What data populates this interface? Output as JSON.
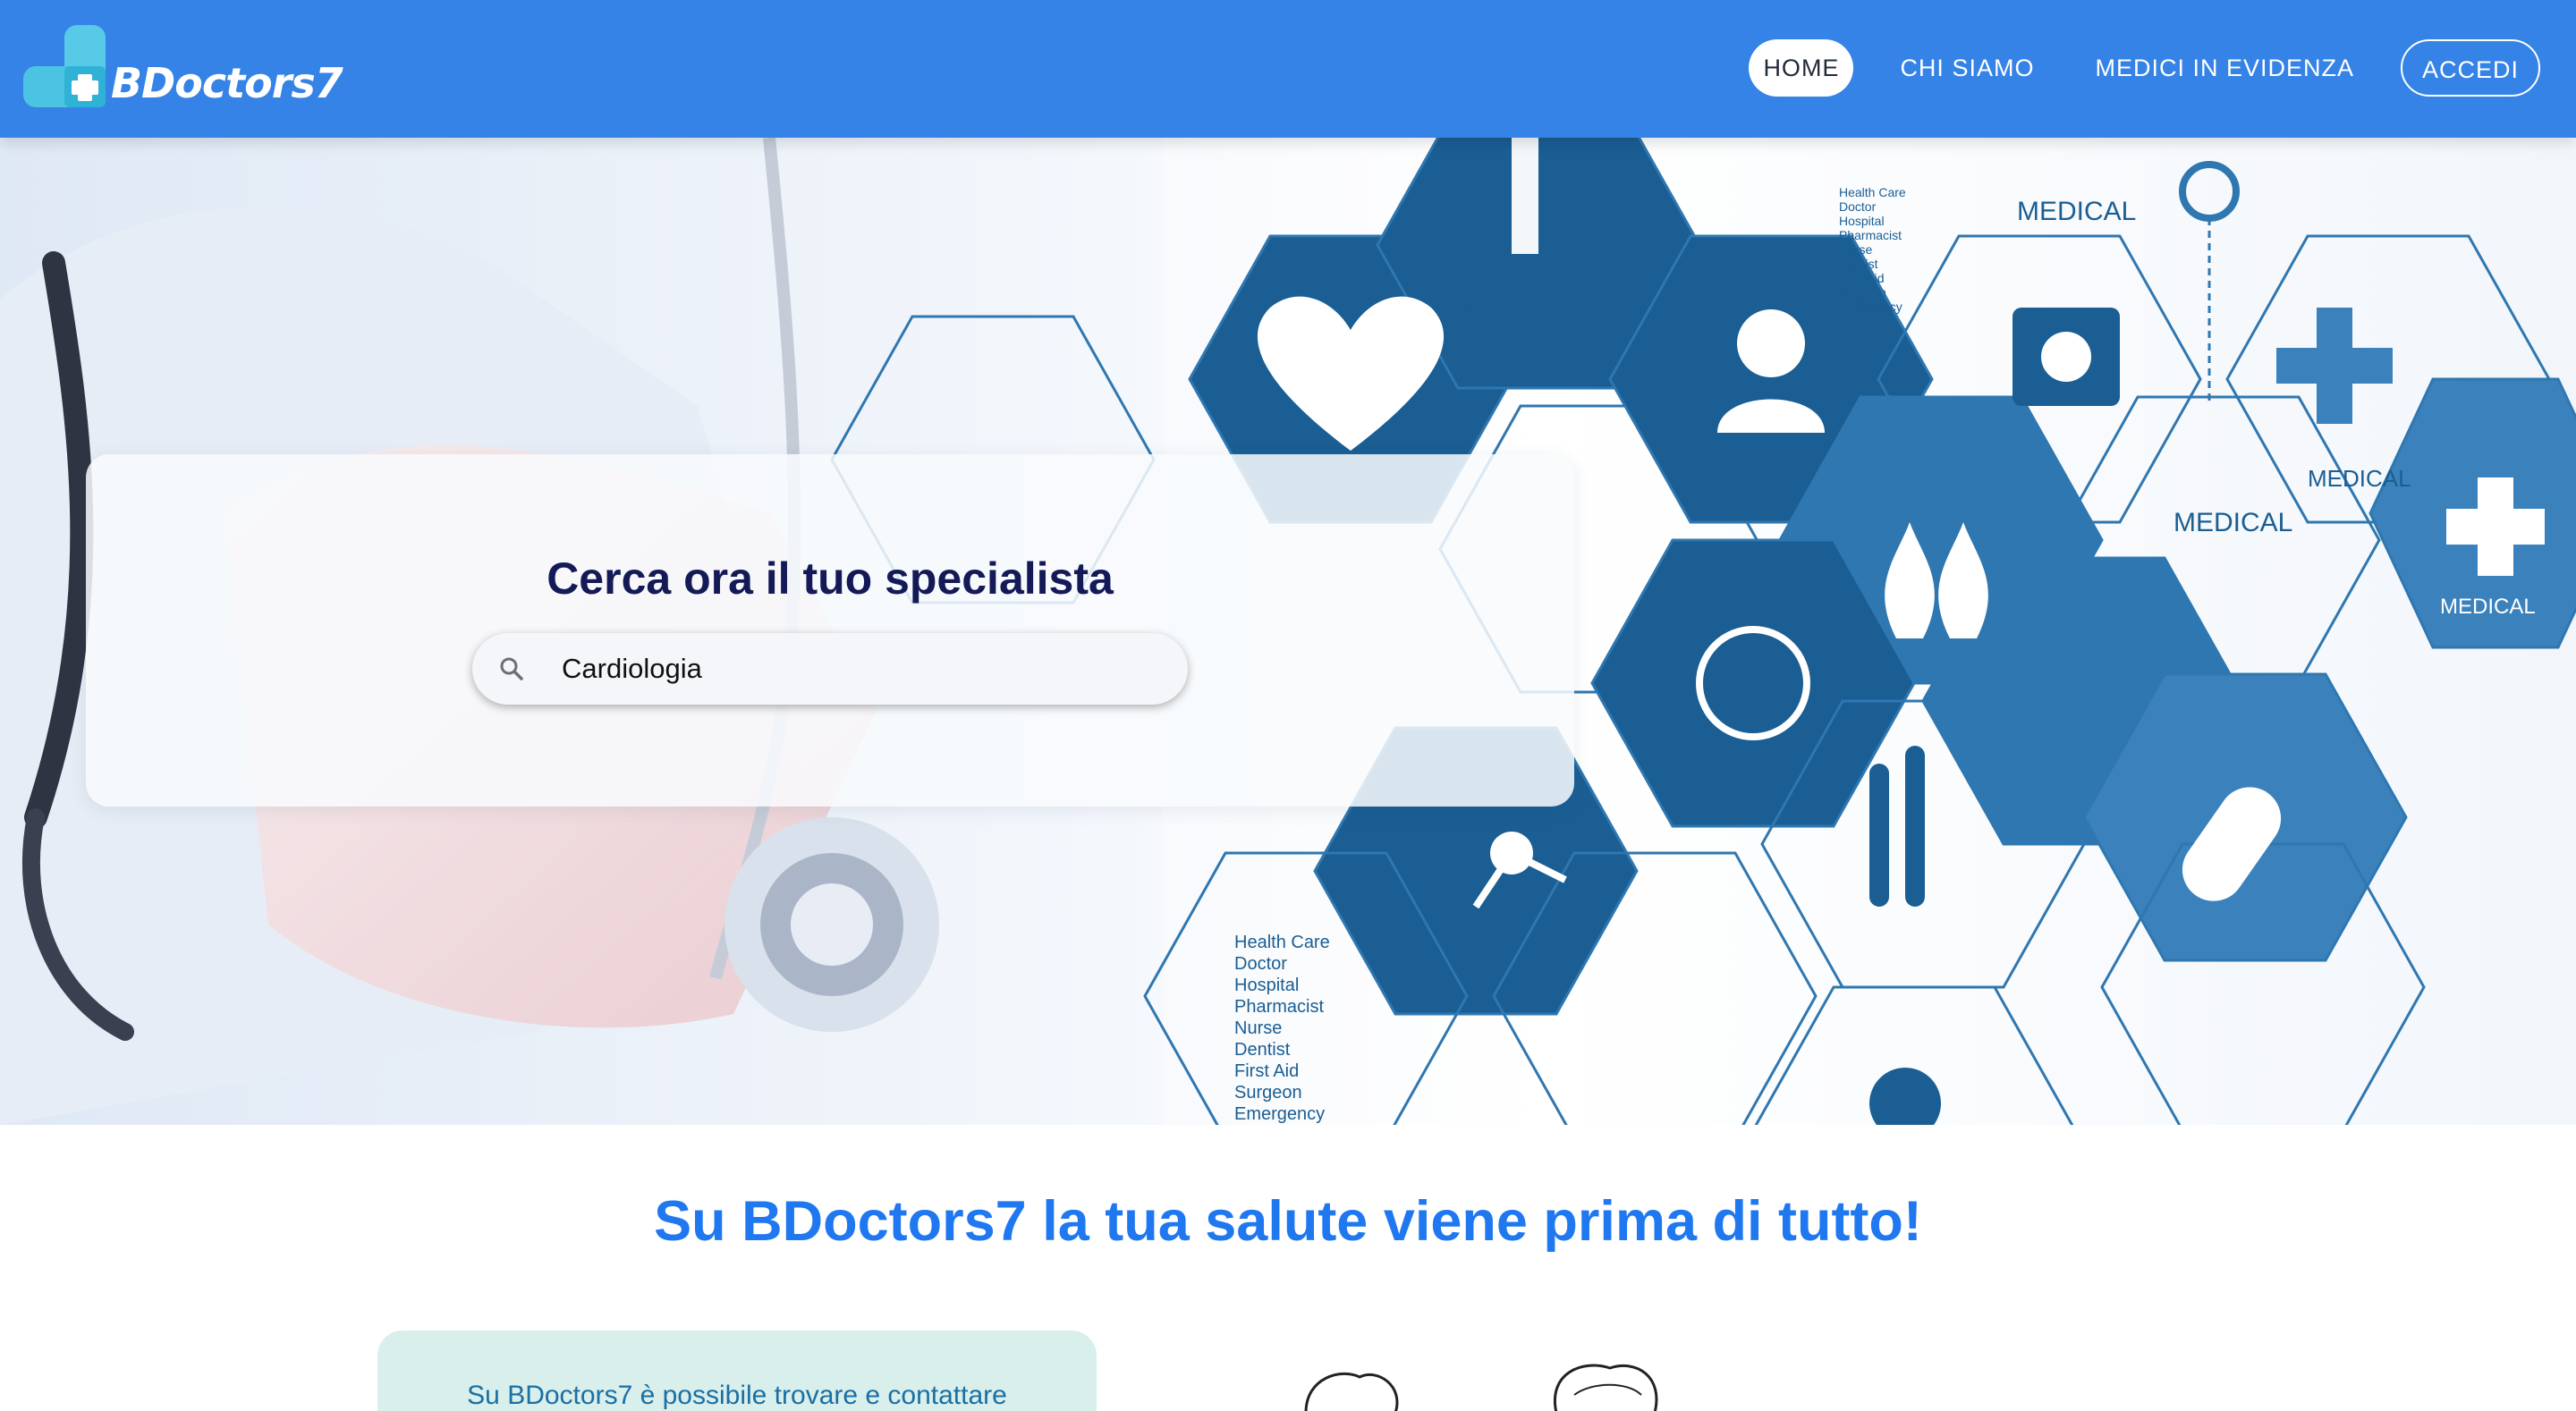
{
  "brand": {
    "name": "BDoctors7"
  },
  "nav": {
    "items": [
      {
        "label": "HOME",
        "active": true
      },
      {
        "label": "CHI SIAMO",
        "active": false
      },
      {
        "label": "MEDICI IN EVIDENZA",
        "active": false
      },
      {
        "label": "ACCEDI",
        "active": false
      }
    ]
  },
  "hero": {
    "title": "Cerca ora il tuo specialista",
    "search": {
      "value": "Cardiologia",
      "icon": "search-icon"
    },
    "background_labels": {
      "medical": "MEDICAL",
      "list_lines": [
        "Health Care",
        "Doctor",
        "Hospital",
        "Pharmacist",
        "Nurse",
        "Dentist",
        "First Aid",
        "Surgeon",
        "Emergency"
      ]
    }
  },
  "tagline": "Su BDoctors7 la tua salute viene prima di tutto!",
  "info": {
    "text": "Su BDoctors7 è possibile trovare e contattare"
  },
  "colors": {
    "navbar": "#3583e6",
    "accent": "#1f78f0",
    "hex_dark": "#1a5e93",
    "hex_mid": "#2f77b0",
    "title_navy": "#141a57",
    "info_card": "#d8efec"
  }
}
